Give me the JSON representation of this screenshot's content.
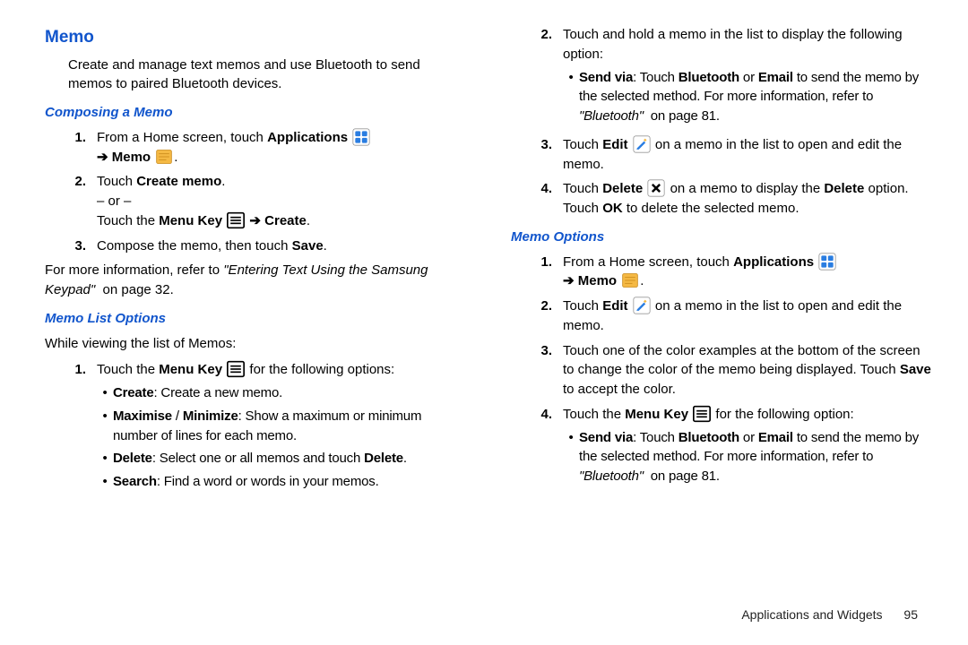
{
  "h1": "Memo",
  "intro": "Create and manage text memos and use Bluetooth to send memos to paired Bluetooth devices.",
  "s_compose": {
    "title": "Composing a Memo",
    "step1_a": "From a Home screen, touch ",
    "step1_b": "Applications",
    "step1_c": "Memo",
    "step2_a": "Touch ",
    "step2_b": "Create memo",
    "step2_or": "– or –",
    "step2_d": "Touch the ",
    "step2_e": "Menu Key",
    "step2_f": "Create",
    "step3_a": "Compose the memo, then touch ",
    "step3_b": "Save",
    "xref_a": "For more information, refer to ",
    "xref_b": "\"Entering Text Using the Samsung Keypad\"",
    "xref_c": "on page 32."
  },
  "s_list": {
    "title": "Memo List Options",
    "intro": "While viewing the list of Memos:",
    "step1_a": "Touch the ",
    "step1_b": "Menu Key",
    "step1_c": " for the following options:",
    "b1_a": "Create",
    "b1_b": ": Create a new memo.",
    "b2_a": "Maximise",
    "b2_b": " / ",
    "b2_c": "Minimize",
    "b2_d": ": Show a maximum or minimum number of lines for each memo.",
    "b3_a": "Delete",
    "b3_b": ": Select one or all memos and touch ",
    "b3_c": "Delete",
    "b4_a": "Search",
    "b4_b": ": Find a word or words in your memos."
  },
  "r_top": {
    "step2_a": "Touch and hold a memo in the list to display the following option:",
    "b1_a": "Send via",
    "b1_b": ": Touch ",
    "b1_c": "Bluetooth",
    "b1_d": " or ",
    "b1_e": "Email",
    "b1_f": " to send the memo by the selected method. For more information, refer to ",
    "b1_g": "\"Bluetooth\"",
    "b1_h": "on page 81.",
    "step3_a": "Touch ",
    "step3_b": "Edit",
    "step3_c": " on a memo in the list to open and edit the memo.",
    "step4_a": "Touch ",
    "step4_b": "Delete",
    "step4_c": " on a memo to display the ",
    "step4_d": "Delete",
    "step4_e": " option. Touch ",
    "step4_f": "OK",
    "step4_g": " to delete the selected memo."
  },
  "s_opts": {
    "title": "Memo Options",
    "step1_a": "From a Home screen, touch ",
    "step1_b": "Applications",
    "step1_c": "Memo",
    "step2_a": "Touch ",
    "step2_b": "Edit",
    "step2_c": " on a memo in the list to open and edit the memo.",
    "step3": "Touch one of the color examples at the bottom of the screen to change the color of the memo being displayed. Touch ",
    "step3_b": "Save",
    "step3_c": " to accept the color.",
    "step4_a": "Touch the ",
    "step4_b": "Menu Key",
    "step4_c": " for the following option:",
    "b1_a": "Send via",
    "b1_b": ": Touch ",
    "b1_c": "Bluetooth",
    "b1_d": " or ",
    "b1_e": "Email",
    "b1_f": " to send the memo by the selected method. For more information, refer to ",
    "b1_g": "\"Bluetooth\"",
    "b1_h": "on page 81."
  },
  "footer": {
    "section": "Applications and Widgets",
    "page": "95"
  },
  "glyphs": {
    "arrow": "➔",
    "dot": "•",
    "period": "."
  }
}
